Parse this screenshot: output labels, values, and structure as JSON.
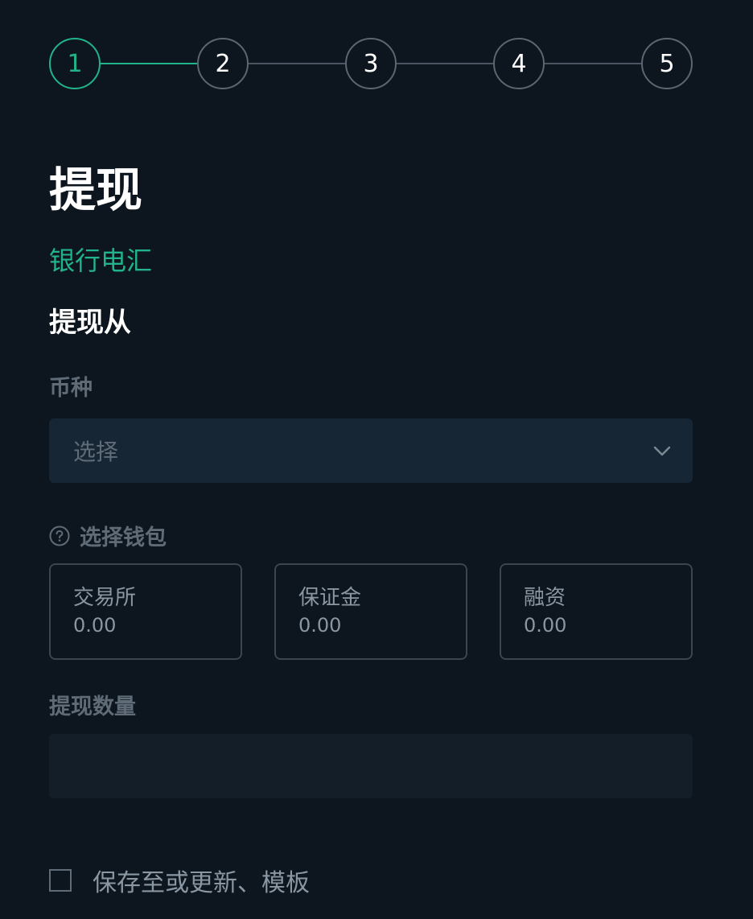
{
  "stepper": {
    "steps": [
      "1",
      "2",
      "3",
      "4",
      "5"
    ],
    "active_index": 0
  },
  "page": {
    "title": "提现",
    "method": "银行电汇",
    "section_title": "提现从"
  },
  "currency": {
    "label": "币种",
    "placeholder": "选择"
  },
  "wallet": {
    "label": "选择钱包",
    "options": [
      {
        "name": "交易所",
        "balance": "0.00"
      },
      {
        "name": "保证金",
        "balance": "0.00"
      },
      {
        "name": "融资",
        "balance": "0.00"
      }
    ]
  },
  "amount": {
    "label": "提现数量",
    "value": ""
  },
  "template": {
    "label": "保存至或更新、模板",
    "checked": false
  },
  "colors": {
    "background": "#0d161e",
    "accent": "#22b38a",
    "input_bg": "#172634",
    "muted_text": "#5f6b77"
  }
}
